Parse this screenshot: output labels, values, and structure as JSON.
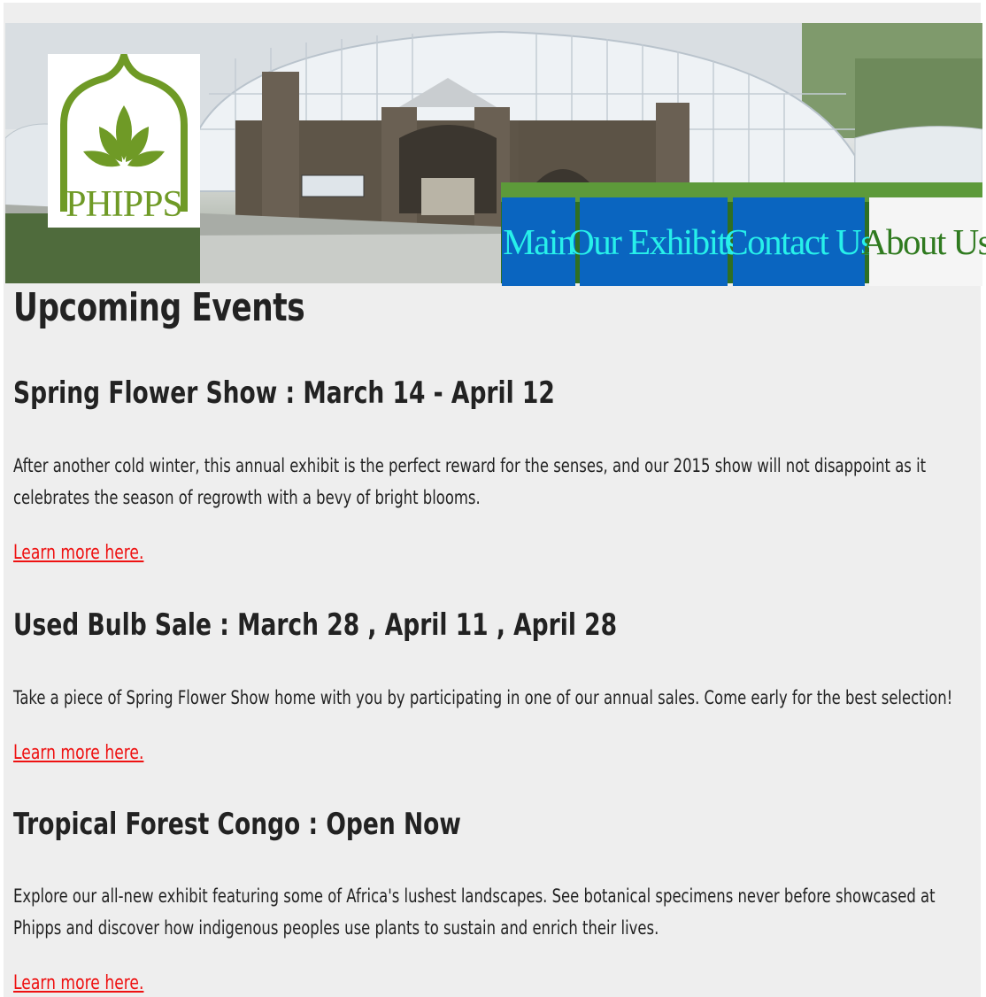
{
  "logo": {
    "text": "PHIPPS"
  },
  "nav": {
    "items": [
      {
        "label": "Main"
      },
      {
        "label": "Our Exhibits"
      },
      {
        "label": "Contact Us"
      },
      {
        "label": "About Us"
      }
    ],
    "active": "About Us",
    "colors": {
      "tab_bg": "#0a65c0",
      "tab_text": "#27f0ea",
      "active_bg": "#f5f5f5",
      "active_text": "#2f7a1f"
    }
  },
  "main": {
    "heading": "Upcoming Events",
    "events": [
      {
        "title": "Spring Flower Show : March 14 - April 12",
        "description": "After another cold winter, this annual exhibit is the perfect reward for the senses, and our 2015 show will not disappoint as it celebrates the season of regrowth with a bevy of bright blooms.",
        "link": "Learn more here."
      },
      {
        "title": "Used Bulb Sale : March 28 , April 11 , April 28",
        "description": "Take a piece of Spring Flower Show home with you by participating in one of our annual sales. Come early for the best selection!",
        "link": "Learn more here."
      },
      {
        "title": "Tropical Forest Congo : Open Now",
        "description": "Explore our all-new exhibit featuring some of Africa's lushest landscapes. See botanical specimens never before showcased at Phipps and discover how indigenous peoples use plants to sustain and enrich their lives.",
        "link": "Learn more here."
      }
    ]
  },
  "colors": {
    "page_bg": "#eeeeee",
    "link": "#ee1111",
    "logo_green": "#6f9a26"
  }
}
